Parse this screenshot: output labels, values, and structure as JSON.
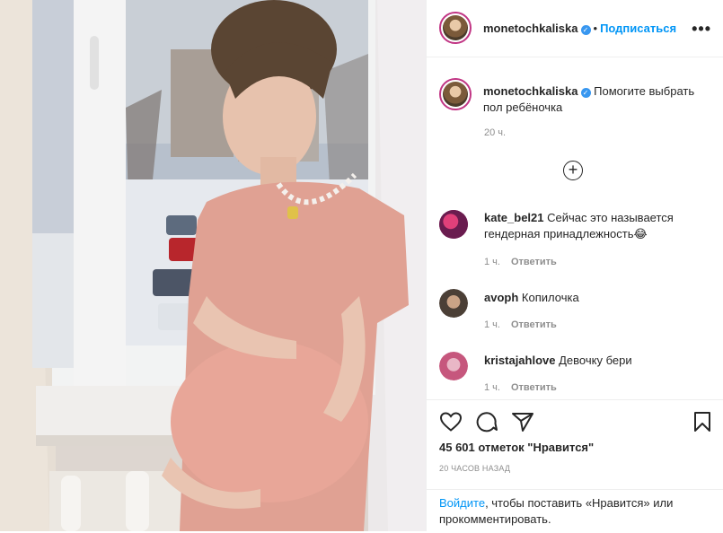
{
  "post": {
    "username": "monetochkaliska",
    "follow_label": "Подписаться",
    "more_label": "•••",
    "caption": "Помогите выбрать пол ребёночка",
    "caption_time": "20 ч.",
    "load_more_label": "+"
  },
  "comments": [
    {
      "username": "kate_bel21",
      "text": "Сейчас это называется гендерная принадлежность😂",
      "time": "1 ч.",
      "reply_label": "Ответить"
    },
    {
      "username": "avoph",
      "text": "Копилочка",
      "time": "1 ч.",
      "reply_label": "Ответить"
    },
    {
      "username": "kristajahlove",
      "text": "Девочку бери",
      "time": "1 ч.",
      "reply_label": "Ответить"
    }
  ],
  "footer": {
    "likes": "45 601 отметок \"Нравится\"",
    "posted_ago": "20 ЧАСОВ НАЗАД",
    "login_link": "Войдите",
    "login_rest": ", чтобы поставить «Нравится» или прокомментировать."
  },
  "icons": {
    "like": "heart-icon",
    "comment": "comment-icon",
    "share": "share-icon",
    "save": "bookmark-icon",
    "verified": "verified-badge-icon"
  },
  "colors": {
    "link": "#0095f6",
    "verified": "#3897f0",
    "secondary_text": "#8e8e8e",
    "border": "#efefef"
  }
}
